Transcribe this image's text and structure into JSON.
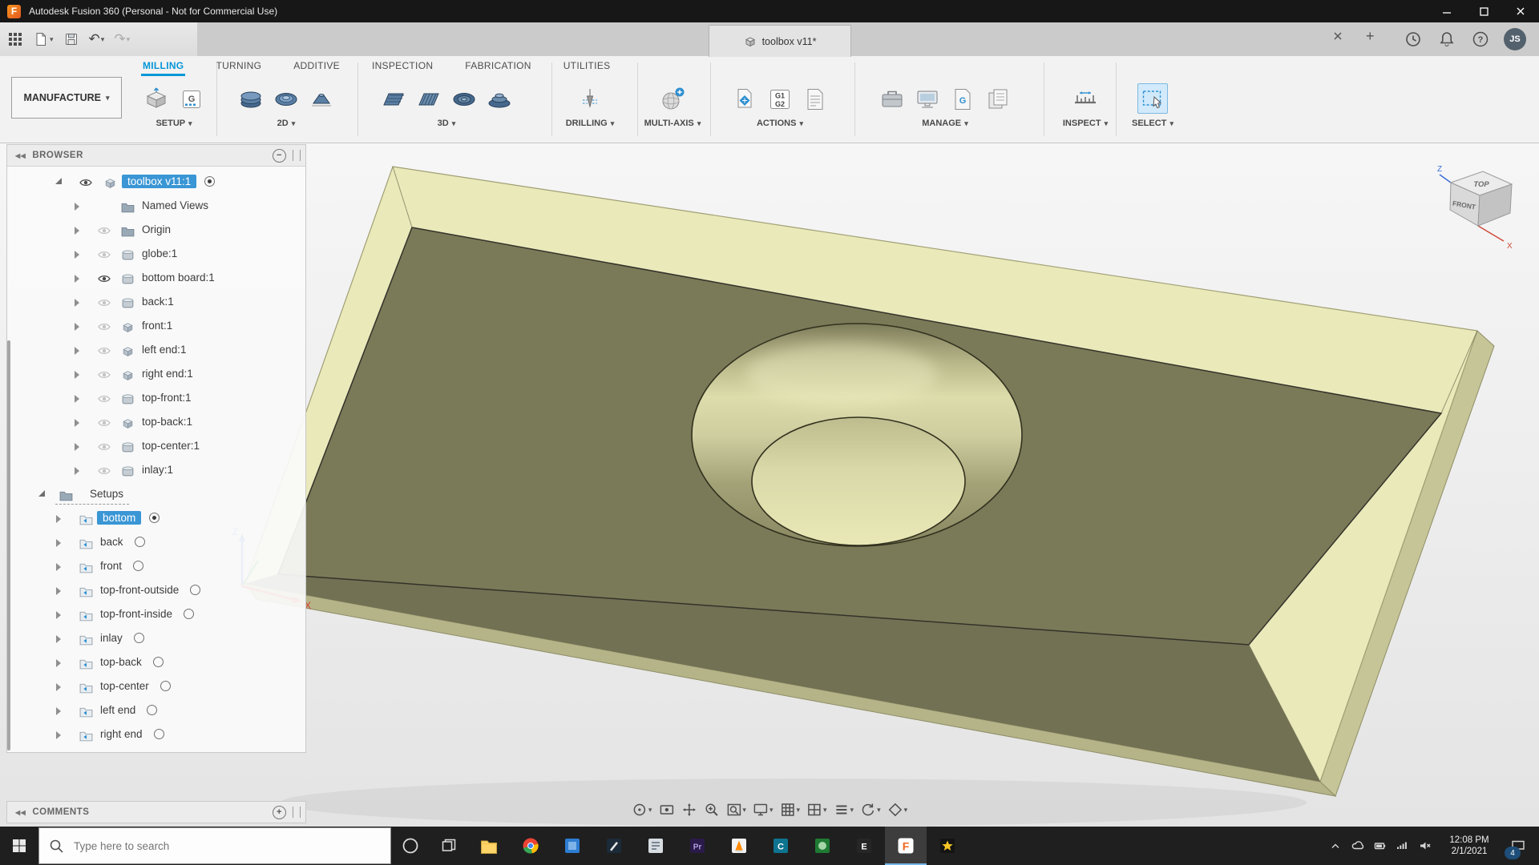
{
  "title_bar": {
    "app_title": "Autodesk Fusion 360 (Personal - Not for Commercial Use)"
  },
  "app_bar": {
    "document_tab": "toolbox v11*",
    "avatar_initials": "JS"
  },
  "ribbon": {
    "workspace_button": "MANUFACTURE",
    "tabs": [
      {
        "label": "MILLING",
        "active": true
      },
      {
        "label": "TURNING",
        "active": false
      },
      {
        "label": "ADDITIVE",
        "active": false
      },
      {
        "label": "INSPECTION",
        "active": false
      },
      {
        "label": "FABRICATION",
        "active": false
      },
      {
        "label": "UTILITIES",
        "active": false
      }
    ],
    "groups": [
      {
        "label": "SETUP",
        "icons": [
          "stock-setup",
          "generate-g"
        ]
      },
      {
        "label": "2D",
        "icons": [
          "face",
          "adaptive-2d",
          "chamfer-2d"
        ]
      },
      {
        "label": "3D",
        "icons": [
          "adaptive-3d",
          "parallel-3d",
          "pocket-3d",
          "spiral-3d"
        ]
      },
      {
        "label": "DRILLING",
        "icons": [
          "drill"
        ]
      },
      {
        "label": "MULTI-AXIS",
        "icons": [
          "multi-axis"
        ]
      },
      {
        "label": "ACTIONS",
        "icons": [
          "post-process",
          "g1g2-simulate",
          "setup-sheet"
        ]
      },
      {
        "label": "MANAGE",
        "icons": [
          "tool-library",
          "machine-library",
          "nc-program",
          "templates"
        ]
      },
      {
        "label": "INSPECT",
        "icons": [
          "measure"
        ]
      },
      {
        "label": "SELECT",
        "icons": [
          "select-window"
        ],
        "highlight": true
      }
    ]
  },
  "browser": {
    "header": "BROWSER",
    "root": {
      "label": "toolbox v11:1",
      "selected": true
    },
    "items": [
      {
        "label": "Named Views",
        "icon": "folder",
        "eye": "none"
      },
      {
        "label": "Origin",
        "icon": "folder",
        "eye": "hidden"
      },
      {
        "label": "globe:1",
        "icon": "body",
        "eye": "hidden"
      },
      {
        "label": "bottom board:1",
        "icon": "body",
        "eye": "visible"
      },
      {
        "label": "back:1",
        "icon": "body",
        "eye": "hidden"
      },
      {
        "label": "front:1",
        "icon": "component",
        "eye": "hidden"
      },
      {
        "label": "left end:1",
        "icon": "component",
        "eye": "hidden"
      },
      {
        "label": "right end:1",
        "icon": "component",
        "eye": "hidden"
      },
      {
        "label": "top-front:1",
        "icon": "body",
        "eye": "hidden"
      },
      {
        "label": "top-back:1",
        "icon": "component",
        "eye": "hidden"
      },
      {
        "label": "top-center:1",
        "icon": "body",
        "eye": "hidden"
      },
      {
        "label": "inlay:1",
        "icon": "body",
        "eye": "hidden"
      }
    ],
    "setups": {
      "label": "Setups",
      "children": [
        {
          "label": "bottom",
          "selected": true,
          "marker": "dot"
        },
        {
          "label": "back",
          "selected": false,
          "marker": "circle"
        },
        {
          "label": "front",
          "selected": false,
          "marker": "circle"
        },
        {
          "label": "top-front-outside",
          "selected": false,
          "marker": "circle"
        },
        {
          "label": "top-front-inside",
          "selected": false,
          "marker": "circle"
        },
        {
          "label": "inlay",
          "selected": false,
          "marker": "circle"
        },
        {
          "label": "top-back",
          "selected": false,
          "marker": "circle"
        },
        {
          "label": "top-center",
          "selected": false,
          "marker": "circle"
        },
        {
          "label": "left end",
          "selected": false,
          "marker": "circle"
        },
        {
          "label": "right end",
          "selected": false,
          "marker": "circle"
        }
      ]
    }
  },
  "comments_panel": {
    "header": "COMMENTS"
  },
  "viewport": {
    "view_cube": {
      "top_label": "TOP",
      "front_label": "FRONT",
      "x_axis": "X",
      "z_axis": "Z"
    },
    "triad": {
      "x_axis": "X",
      "z_axis": "Z"
    },
    "nav_toolbar": [
      {
        "name": "orbit",
        "caret": true
      },
      {
        "name": "look-at",
        "caret": false
      },
      {
        "name": "pan",
        "caret": false
      },
      {
        "name": "zoom",
        "caret": false
      },
      {
        "name": "fit",
        "caret": true
      },
      {
        "name": "display-settings",
        "caret": true
      },
      {
        "name": "grid-and-snaps",
        "caret": true
      },
      {
        "name": "viewports",
        "caret": true
      },
      {
        "name": "layout-rows",
        "caret": true
      },
      {
        "name": "refresh-view",
        "caret": true
      },
      {
        "name": "visual-style",
        "caret": true
      }
    ]
  },
  "taskbar": {
    "search_placeholder": "Type here to search",
    "apps": [
      {
        "name": "file-explorer",
        "active": false
      },
      {
        "name": "chrome",
        "active": false
      },
      {
        "name": "blue-app",
        "active": false
      },
      {
        "name": "photo-editor",
        "active": false
      },
      {
        "name": "notes-app",
        "active": false
      },
      {
        "name": "purple-p-app",
        "active": false
      },
      {
        "name": "media-player",
        "active": false
      },
      {
        "name": "teal-c-app",
        "active": false
      },
      {
        "name": "green-app",
        "active": false
      },
      {
        "name": "e-app",
        "active": false
      },
      {
        "name": "fusion-360",
        "active": true
      },
      {
        "name": "star-app",
        "active": false
      }
    ],
    "tray": [
      "chevron-up",
      "cloud",
      "battery",
      "network",
      "volume-muted"
    ],
    "clock": {
      "time": "12:08 PM",
      "date": "2/1/2021"
    },
    "notification_badge": "4"
  },
  "colors": {
    "accent": "#0696d7",
    "selection": "#3a96d5",
    "model_dark_face": "#7b7a58",
    "model_stock": "#e9e8b8",
    "titlebar": "#171717",
    "taskbar": "#1f1f1f"
  }
}
